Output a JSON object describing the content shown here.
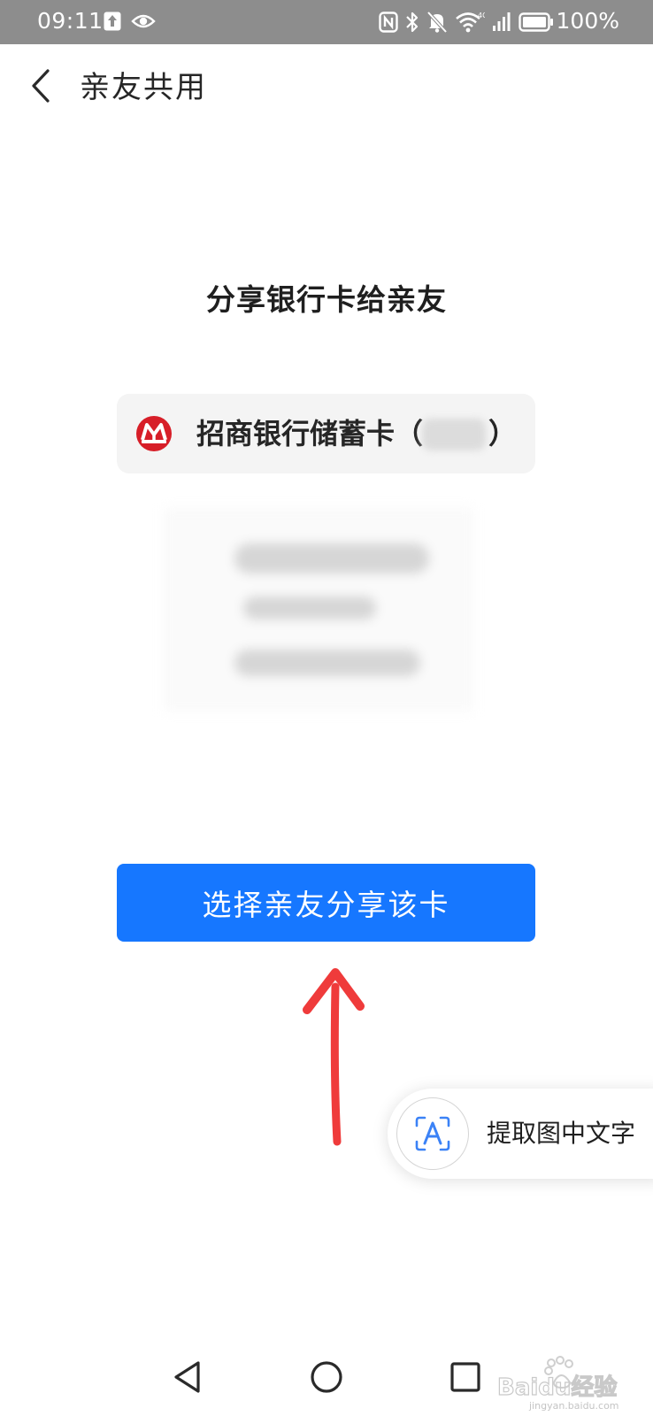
{
  "status_bar": {
    "time": "09:11",
    "battery_percent": "100%",
    "network_type": "4G",
    "icons_left": [
      "upload-icon",
      "eye-icon"
    ],
    "icons_right": [
      "nfc-icon",
      "bluetooth-icon",
      "mute-bell-icon",
      "wifi-icon",
      "signal-icon",
      "battery-icon"
    ]
  },
  "header": {
    "back_icon": "chevron-left-icon",
    "title": "亲友共用"
  },
  "main": {
    "heading": "分享银行卡给亲友",
    "card": {
      "logo": "cmb-bank-logo",
      "label": "招商银行储蓄卡（",
      "label_close": "）",
      "number_masked": true
    },
    "share_button_label": "选择亲友分享该卡"
  },
  "ocr_chip": {
    "icon": "text-recognition-icon",
    "label": "提取图中文字"
  },
  "nav_bar": {
    "back_icon": "triangle-back-icon",
    "home_icon": "circle-home-icon",
    "recents_icon": "square-recents-icon"
  },
  "watermark": {
    "brand": "Baidu经验",
    "url": "jingyan.baidu.com"
  },
  "colors": {
    "primary_button": "#1677ff",
    "status_bar_bg": "#8d8d8d",
    "card_pill_bg": "#f4f4f4",
    "bank_logo_red": "#d71e28",
    "annotation_arrow": "#ef3b3b"
  }
}
